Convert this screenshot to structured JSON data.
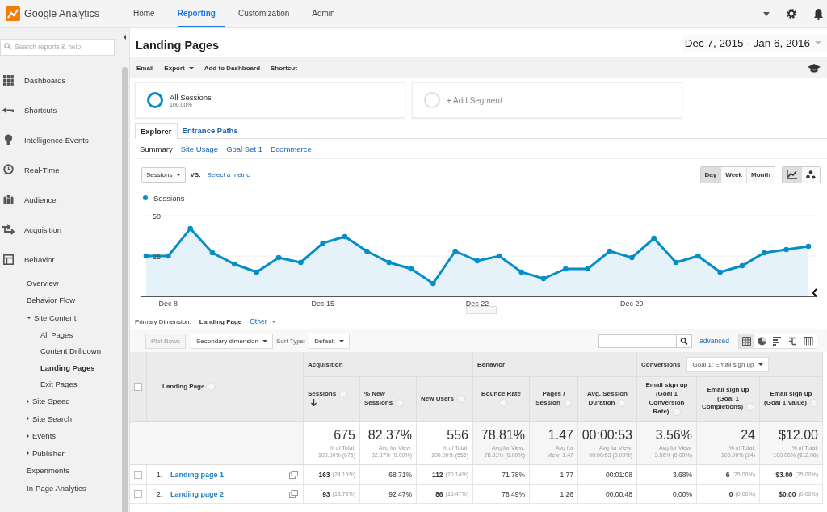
{
  "app": {
    "name": "Google Analytics"
  },
  "nav": [
    {
      "label": "Home",
      "selected": false
    },
    {
      "label": "Reporting",
      "selected": true
    },
    {
      "label": "Customization",
      "selected": false
    },
    {
      "label": "Admin",
      "selected": false
    }
  ],
  "sidebar": {
    "search_placeholder": "Search reports & help",
    "items": [
      {
        "label": "Dashboards",
        "selected": false
      },
      {
        "label": "Shortcuts",
        "selected": false
      },
      {
        "label": "Intelligence Events",
        "selected": false
      },
      {
        "label": "Real-Time",
        "selected": false
      },
      {
        "label": "Audience",
        "selected": false
      },
      {
        "label": "Acquisition",
        "selected": false
      },
      {
        "label": "Behavior",
        "selected": false,
        "children": [
          {
            "label": "Overview",
            "selected": false
          },
          {
            "label": "Behavior Flow",
            "selected": false
          },
          {
            "label": "Site Content",
            "selected": false,
            "expanded": true,
            "children": [
              {
                "label": "All Pages",
                "selected": false
              },
              {
                "label": "Content Drilldown",
                "selected": false
              },
              {
                "label": "Landing Pages",
                "selected": true
              },
              {
                "label": "Exit Pages",
                "selected": false
              }
            ]
          },
          {
            "label": "Site Speed",
            "selected": false,
            "expanded": false
          },
          {
            "label": "Site Search",
            "selected": false,
            "expanded": false
          },
          {
            "label": "Events",
            "selected": false,
            "expanded": false
          },
          {
            "label": "Publisher",
            "selected": false,
            "expanded": false
          },
          {
            "label": "Experiments",
            "selected": false
          },
          {
            "label": "In-Page Analytics",
            "selected": false
          }
        ]
      }
    ]
  },
  "report": {
    "title": "Landing Pages",
    "date_range": "Dec 7, 2015 - Jan 6, 2016",
    "actions": [
      {
        "label": "Email",
        "dropdown": false
      },
      {
        "label": "Export",
        "dropdown": true
      },
      {
        "label": "Add to Dashboard",
        "dropdown": false
      },
      {
        "label": "Shortcut",
        "dropdown": false
      }
    ]
  },
  "segments": [
    {
      "kind": "active",
      "label": "All Sessions",
      "share": "100.00%"
    },
    {
      "kind": "add",
      "label": "+ Add Segment"
    }
  ],
  "explorer_tabs": [
    {
      "label": "Explorer",
      "selected": true
    },
    {
      "label": "Entrance Paths",
      "selected": false
    }
  ],
  "subtabs": [
    {
      "label": "Summary",
      "selected": true
    },
    {
      "label": "Site Usage",
      "selected": false
    },
    {
      "label": "Goal Set 1",
      "selected": false
    },
    {
      "label": "Ecommerce",
      "selected": false
    }
  ],
  "chart_controls": {
    "metric": "Sessions",
    "vs": "VS.",
    "select_metric": "Select a metric",
    "periods": [
      {
        "label": "Day",
        "selected": true
      },
      {
        "label": "Week",
        "selected": false
      },
      {
        "label": "Month",
        "selected": false
      }
    ],
    "views": [
      {
        "kind": "line",
        "selected": true
      },
      {
        "kind": "motion",
        "selected": false
      }
    ]
  },
  "chart": {
    "x_labels": [
      "Dec 8",
      "Dec 15",
      "Dec 22",
      "Dec 29"
    ],
    "chart_data": {
      "type": "area",
      "ylim": [
        0,
        50
      ],
      "yticks": [
        25,
        50
      ],
      "series": [
        {
          "name": "Sessions",
          "color": "#058dc7",
          "values": [
            25,
            25,
            42,
            27,
            20,
            15,
            24,
            21,
            33,
            37,
            28,
            21,
            17,
            8,
            28,
            22,
            25,
            15,
            11,
            17,
            17,
            28,
            24,
            36,
            21,
            25,
            15,
            19,
            27,
            29,
            31
          ]
        }
      ]
    }
  },
  "primary_dimension": {
    "label": "Primary Dimension:",
    "value": "Landing Page",
    "other": "Other"
  },
  "table_toolbar": {
    "plot_rows": {
      "label": "Plot Rows",
      "disabled": true
    },
    "secondary": "Secondary dimension",
    "sort_label": "Sort Type:",
    "sort_value": "Default",
    "advanced": "advanced",
    "views": [
      {
        "kind": "table",
        "selected": true
      },
      {
        "kind": "pie",
        "selected": false
      },
      {
        "kind": "bars",
        "selected": false
      },
      {
        "kind": "compare",
        "selected": false
      },
      {
        "kind": "pivot",
        "selected": false
      }
    ]
  },
  "table": {
    "dimension": "Landing Page",
    "header_checked": false,
    "groups": [
      {
        "label": "Acquisition",
        "columns": [
          {
            "label": "Sessions",
            "sorted": true
          },
          {
            "label": "% New Sessions",
            "sorted": false
          },
          {
            "label": "New Users",
            "sorted": false
          }
        ]
      },
      {
        "label": "Behavior",
        "columns": [
          {
            "label": "Bounce Rate",
            "sorted": false
          },
          {
            "label": "Pages / Session",
            "sorted": false
          },
          {
            "label": "Avg. Session Duration",
            "sorted": false
          }
        ]
      },
      {
        "label": "Conversions",
        "goal": "Goal 1: Email sign up",
        "columns": [
          {
            "label": "Email sign up (Goal 1 Conversion Rate)",
            "sorted": false
          },
          {
            "label": "Email sign up (Goal 1 Completions)",
            "sorted": false
          },
          {
            "label": "Email sign up (Goal 1 Value)",
            "sorted": false
          }
        ]
      }
    ],
    "totals": [
      {
        "value": "675",
        "note": [
          "% of Total:",
          "100.00% (675)"
        ]
      },
      {
        "value": "82.37%",
        "note": [
          "Avg for View:",
          "82.37% (0.00%)"
        ]
      },
      {
        "value": "556",
        "note": [
          "% of Total:",
          "100.00% (556)"
        ]
      },
      {
        "value": "78.81%",
        "note": [
          "Avg for View:",
          "78.81% (0.00%)"
        ]
      },
      {
        "value": "1.47",
        "note": [
          "Avg for",
          "View: 1.47"
        ]
      },
      {
        "value": "00:00:53",
        "note": [
          "Avg for View:",
          "00:00:53 (0.00%)"
        ]
      },
      {
        "value": "3.56%",
        "note": [
          "Avg for View:",
          "3.56% (0.00%)"
        ]
      },
      {
        "value": "24",
        "note": [
          "% of Total:",
          "100.00% (24)"
        ]
      },
      {
        "value": "$12.00",
        "note": [
          "% of Total:",
          "100.00% ($12.00)"
        ]
      }
    ],
    "rows": [
      {
        "index": "1.",
        "page": "Landing page 1",
        "checked": false,
        "cells": [
          {
            "value": "163",
            "share": "(24.15%)"
          },
          {
            "value": "68.71%"
          },
          {
            "value": "112",
            "share": "(20.14%)"
          },
          {
            "value": "71.78%"
          },
          {
            "value": "1.77"
          },
          {
            "value": "00:01:08"
          },
          {
            "value": "3.68%"
          },
          {
            "value": "6",
            "share": "(25.00%)"
          },
          {
            "value": "$3.00",
            "share": "(25.00%)"
          }
        ]
      },
      {
        "index": "2.",
        "page": "Landing page 2",
        "checked": false,
        "cells": [
          {
            "value": "93",
            "share": "(13.78%)"
          },
          {
            "value": "92.47%"
          },
          {
            "value": "86",
            "share": "(15.47%)"
          },
          {
            "value": "78.49%"
          },
          {
            "value": "1.26"
          },
          {
            "value": "00:00:48"
          },
          {
            "value": "0.00%"
          },
          {
            "value": "0",
            "share": "(0.00%)"
          },
          {
            "value": "$0.00",
            "share": "(0.00%)"
          }
        ]
      }
    ]
  }
}
